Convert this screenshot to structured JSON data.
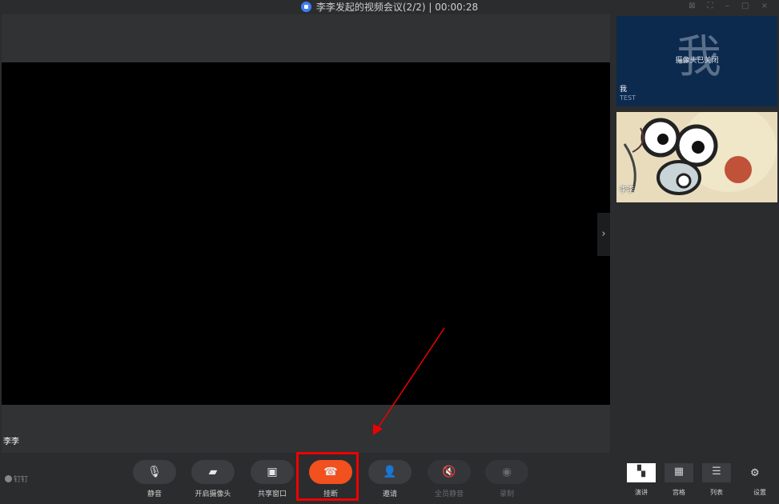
{
  "window": {
    "title": "李李发起的视频会议(2/2) | 00:00:28",
    "controls": "⊠ ⛶ – □ ×"
  },
  "main": {
    "speaker_name": "李李",
    "expand_icon": "›"
  },
  "tiles": {
    "me": {
      "avatar_char": "我",
      "status": "摄像头已关闭",
      "name": "我",
      "sub": "TEST"
    },
    "other": {
      "name": "李李"
    }
  },
  "brand": "钉钉",
  "controls": [
    {
      "key": "mute",
      "label": "静音",
      "icon": "mic-icon",
      "glyph": "🎙"
    },
    {
      "key": "camera",
      "label": "开启摄像头",
      "icon": "camera-off-icon",
      "glyph": "▰"
    },
    {
      "key": "share",
      "label": "共享窗口",
      "icon": "share-screen-icon",
      "glyph": "▣"
    },
    {
      "key": "hangup",
      "label": "挂断",
      "icon": "hangup-icon",
      "glyph": "☎"
    },
    {
      "key": "invite",
      "label": "邀请",
      "icon": "add-person-icon",
      "glyph": "👤"
    },
    {
      "key": "mute_all",
      "label": "全员静音",
      "icon": "mute-all-icon",
      "glyph": "🔇"
    },
    {
      "key": "record",
      "label": "录制",
      "icon": "record-icon",
      "glyph": "◉"
    }
  ],
  "layouts": [
    {
      "label": "演讲",
      "icon": "speaker-layout-icon",
      "glyph": "▚",
      "active": true
    },
    {
      "label": "宫格",
      "icon": "grid-layout-icon",
      "glyph": "▦",
      "active": false
    },
    {
      "label": "列表",
      "icon": "list-layout-icon",
      "glyph": "☰",
      "active": false
    }
  ],
  "settings_label": "设置",
  "colors": {
    "hangup": "#f2501f",
    "highlight": "#e00000",
    "accent": "#3f7ef2"
  }
}
